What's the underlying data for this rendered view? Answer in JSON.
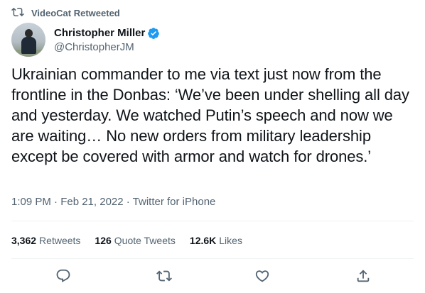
{
  "retweet_banner": {
    "text": "VideoCat Retweeted",
    "icon": "retweet-icon"
  },
  "author": {
    "display_name": "Christopher Miller",
    "handle": "@ChristopherJM",
    "verified": true,
    "verified_color": "#1d9bf0"
  },
  "tweet": {
    "text": "Ukrainian commander to me via text just now from the frontline in the Donbas: ‘We’ve been under shelling all day and yesterday. We watched Putin’s speech and now we are waiting… No new orders from military leadership except be covered with armor and watch for drones.’",
    "meta": "1:09 PM · Feb 21, 2022 · Twitter for iPhone"
  },
  "stats": {
    "retweets": {
      "count": "3,362",
      "label": "Retweets"
    },
    "quote_tweets": {
      "count": "126",
      "label": "Quote Tweets"
    },
    "likes": {
      "count": "12.6K",
      "label": "Likes"
    }
  },
  "actions": [
    "reply-icon",
    "retweet-icon",
    "like-icon",
    "share-icon"
  ],
  "colors": {
    "text": "#0f1419",
    "secondary": "#536471",
    "divider": "#eff3f4"
  }
}
